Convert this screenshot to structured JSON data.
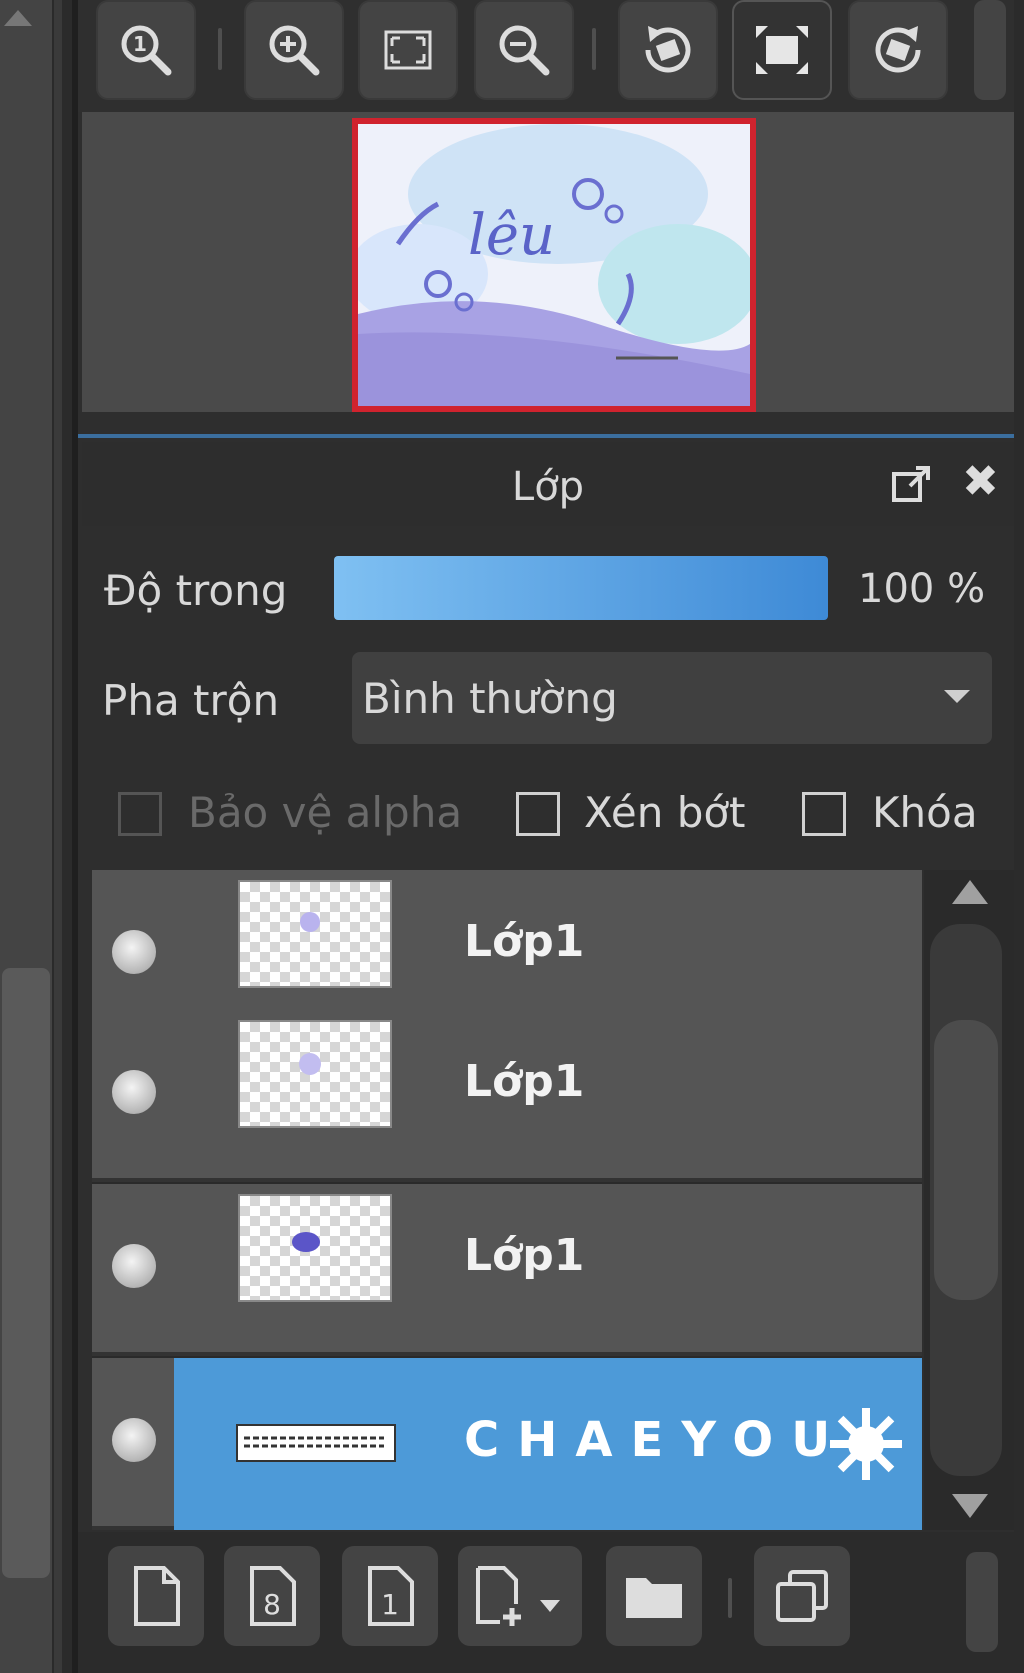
{
  "navigator": {
    "toolbar_icons": [
      "zoom-actual-icon",
      "zoom-in-icon",
      "fit-screen-icon",
      "zoom-out-icon",
      "rotate-left-icon",
      "fullscreen-icon",
      "rotate-right-icon"
    ]
  },
  "layer_panel": {
    "title": "Lớp",
    "opacity": {
      "label": "Độ trong",
      "value": "100 %",
      "fraction": 1.0
    },
    "blend": {
      "label": "Pha trộn",
      "value": "Bình thường"
    },
    "options": {
      "protect_alpha": "Bảo vệ alpha",
      "clipping": "Xén bớt",
      "lock": "Khóa"
    },
    "layers": [
      {
        "name": "Lớp1",
        "selected": false
      },
      {
        "name": "Lớp1",
        "selected": false
      },
      {
        "name": "Lớp1",
        "selected": false
      },
      {
        "name": "CHAEYOU",
        "selected": true
      }
    ]
  },
  "colors": {
    "selected_row": "#4d9ad8",
    "preview_border": "#d0232e",
    "accent": "#3b6e9e"
  }
}
